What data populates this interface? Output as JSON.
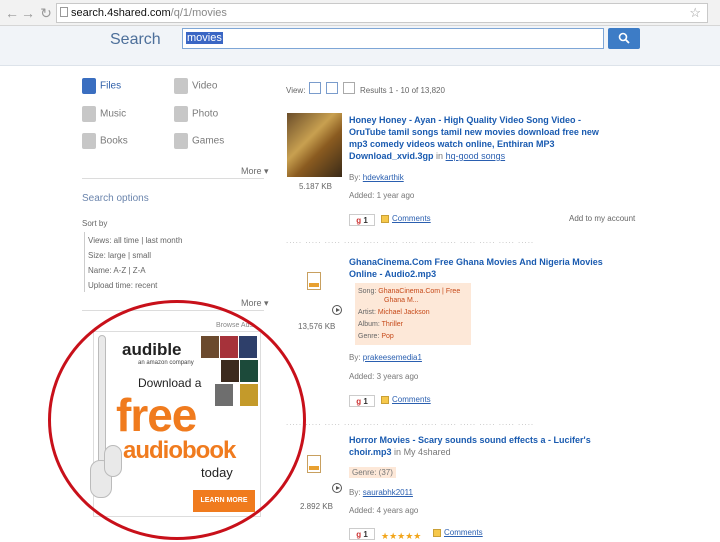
{
  "browser": {
    "url_host": "search.4shared.com",
    "url_path": "/q/1/movies"
  },
  "search": {
    "label": "Search",
    "query": "movies"
  },
  "categories": [
    {
      "label": "Files"
    },
    {
      "label": "Video"
    },
    {
      "label": "Music"
    },
    {
      "label": "Photo"
    },
    {
      "label": "Books"
    },
    {
      "label": "Games"
    }
  ],
  "more_label": "More",
  "options": {
    "title": "Search options",
    "sort_by": "Sort by",
    "rows": [
      "Views: all time | last month",
      "Size: large | small",
      "Name: A-Z | Z-A",
      "Upload time: recent"
    ]
  },
  "ad": {
    "label": "Browse Ads",
    "logo": "audible",
    "logo_sub": "an amazon company",
    "line1": "Download a",
    "line2": "free",
    "line3": "audiobook",
    "line4": "today",
    "cta": "LEARN MORE"
  },
  "results_header": {
    "view_label": "View:",
    "count": "Results 1 - 10 of 13,820"
  },
  "results": [
    {
      "title_lines": [
        "Honey Honey - Ayan - High Quality Video Song Video -",
        "OruTube    tamil songs tamil new movies download free new",
        "mp3 comedy videos watch online, Enthiran MP3",
        "Download_xvid.3gp"
      ],
      "folder_prefix": "in",
      "folder": "hq-good songs",
      "size": "5.187 KB",
      "by_label": "By:",
      "by": "hdevkarthik",
      "added": "Added: 1 year ago",
      "gcount": "1",
      "comments": "Comments",
      "add_lib": "Add to my account"
    },
    {
      "title_lines": [
        "GhanaCinema.Com Free Ghana Movies And Nigeria Movies",
        "Online - Audio2.mp3"
      ],
      "size": "13,576 KB",
      "song_rows": [
        {
          "k": "Song:",
          "v": "GhanaCinema.Com | Free"
        },
        {
          "k": "",
          "v": "Ghana M..."
        },
        {
          "k": "Artist:",
          "v": "Michael Jackson"
        },
        {
          "k": "Album:",
          "v": "Thriller"
        },
        {
          "k": "Genre:",
          "v": "Pop"
        }
      ],
      "by_label": "By:",
      "by": "prakeesemedia1",
      "added": "Added: 3 years ago",
      "gcount": "1",
      "comments": "Comments"
    },
    {
      "title_lines": [
        "Horror Movies - Scary sounds sound effects a - Lucifer's",
        "choir.mp3"
      ],
      "folder_prefix": "in",
      "folder": "My 4shared",
      "size": "2.892 KB",
      "genre": "Genre: (37)",
      "by_label": "By:",
      "by": "saurabhk2011",
      "added": "Added: 4 years ago",
      "gcount": "1",
      "comments": "Comments"
    }
  ],
  "dots": ".....   .....   .....  .....   .....   .....   .....   .....   .....   .....   .....   .....   .....",
  "colors": {
    "accent": "#3d7cc6",
    "link": "#1a5bb0",
    "orange": "#f07b1e",
    "circle": "#c8101a"
  }
}
